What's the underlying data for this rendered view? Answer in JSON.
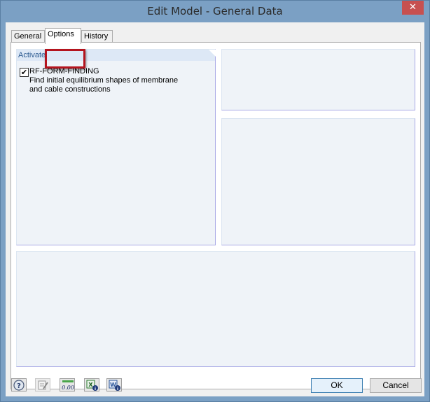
{
  "window": {
    "title": "Edit Model - General Data",
    "close_symbol": "✕"
  },
  "tabs": [
    {
      "label": "General",
      "active": false
    },
    {
      "label": "Options",
      "active": true
    },
    {
      "label": "History",
      "active": false
    }
  ],
  "activate_panel": {
    "header": "Activate",
    "items": [
      {
        "label": "RF-FORM-FINDING",
        "description_line1": "Find initial equilibrium shapes of membrane",
        "description_line2": "and cable constructions",
        "checked": true,
        "check_symbol": "✔"
      }
    ]
  },
  "toolbar_icons": [
    {
      "name": "help-icon"
    },
    {
      "name": "edit-icon"
    },
    {
      "name": "units-decimals-icon",
      "text": "0.00"
    },
    {
      "name": "excel-info-icon"
    },
    {
      "name": "word-info-icon"
    }
  ],
  "buttons": {
    "ok": "OK",
    "cancel": "Cancel"
  },
  "colors": {
    "highlight_border": "#b4141e",
    "close_button": "#c75050",
    "panel_header_text": "#2d5b91"
  }
}
